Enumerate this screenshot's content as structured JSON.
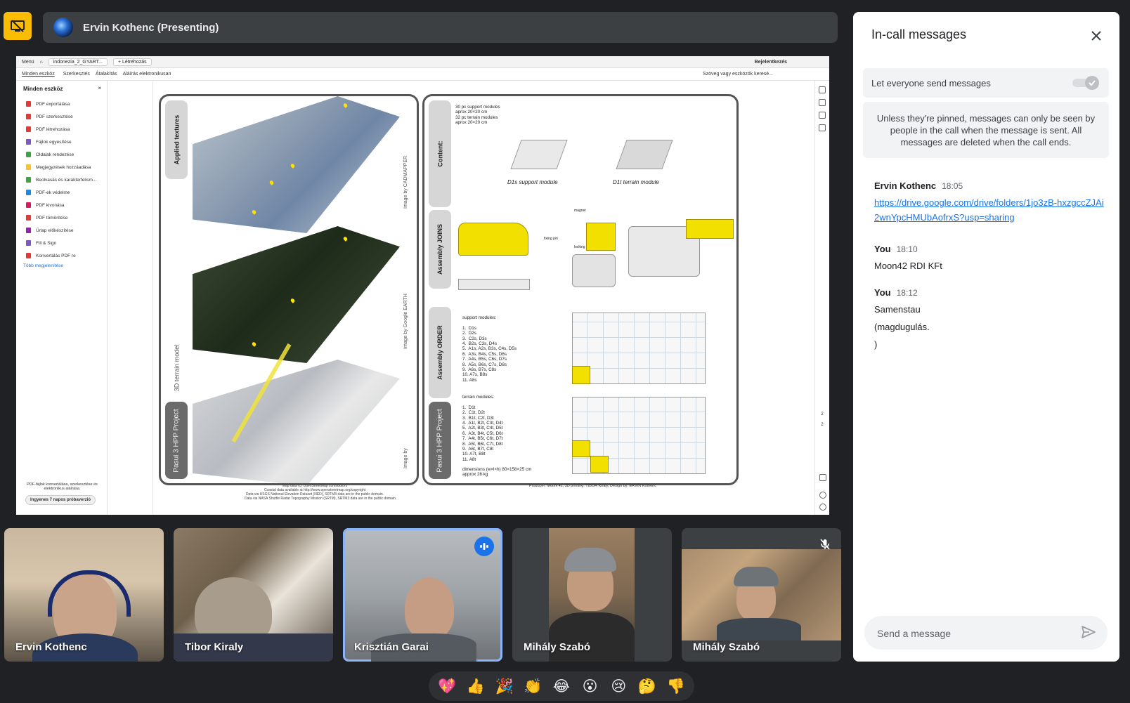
{
  "presenter": {
    "name": "Ervin Kothenc (Presenting)"
  },
  "shared_screen": {
    "toolbar": {
      "menu": "Menü",
      "tab": "indonezia_2_GYART...",
      "new_tab": "+ Létrehozás",
      "signin": "Bejelentkezés"
    },
    "menu_tabs": [
      "Minden eszköz",
      "Szerkesztés",
      "Átalakítás",
      "Aláírás elektronikusan"
    ],
    "search_hint": "Szöveg vagy eszközök keresé...",
    "tools_title": "Minden eszköz",
    "tools": [
      {
        "label": "PDF exportálása",
        "color": "#e53935"
      },
      {
        "label": "PDF szerkesztése",
        "color": "#e53935"
      },
      {
        "label": "PDF létrehozása",
        "color": "#e53935"
      },
      {
        "label": "Fájlok egyesítése",
        "color": "#7e57c2"
      },
      {
        "label": "Oldalak rendezése",
        "color": "#43a047"
      },
      {
        "label": "Megjegyzések hozzáadása",
        "color": "#fbc02d"
      },
      {
        "label": "Beolvasás és karakterfelism...",
        "color": "#43a047"
      },
      {
        "label": "PDF-ek védelme",
        "color": "#1e88e5"
      },
      {
        "label": "PDF kivonása",
        "color": "#d81b60"
      },
      {
        "label": "PDF tömörítése",
        "color": "#e53935"
      },
      {
        "label": "Űrlap előkészítése",
        "color": "#8e24aa"
      },
      {
        "label": "Fill & Sign",
        "color": "#7e57c2"
      },
      {
        "label": "Konvertálás PDF re",
        "color": "#e53935"
      }
    ],
    "tools_more": "Több megjelenítése",
    "tools_footer": "PDF-fájlok konvertálása, szerkesztése és elektronikus aláírása.",
    "tools_trial": "Ingyenes 7 napos próbaverzió",
    "left_panel": {
      "labels": [
        "Applied textures",
        "3D terrain model",
        "Pasui 3 HPP Project"
      ],
      "credits": [
        "Image by CADMAPPER",
        "Image by Google EARTH",
        "Image by"
      ]
    },
    "right_panel": {
      "labels": [
        "Content:",
        "Assembly JOINS",
        "Assembly ORDER",
        "Pasui 3 HPP Project"
      ],
      "content_text": "30 pc support modules\naprox 20×20 cm\n32 pc terrain modules\naprox 20×20 cm",
      "caption_support": "D1s support module",
      "caption_terrain": "D1t terrain module",
      "join_labels": [
        "magnet",
        "fixing pin",
        "locking"
      ],
      "support_list": "support modules:\n\n1.  D1s\n2.  D2s\n3.  C2s, D3s\n4.  B2s, C3s, D4s\n5.  A1s, A2s, B3s, C4s, D5s\n6.  A3s, B4s, C5s, D6s\n7.  A4s, B5s, C6s, D7s\n8.  A5s, B6s, C7s, D8s\n9.  A6s, B7s, C8s\n10. A7s, B8s\n11. A8s",
      "terrain_list": "terrain modules:\n\n1.  D1t\n2.  C1t, D2t\n3.  B1t, C2t, D3t\n4.  A1t, B2t, C3t, D4t\n5.  A2t, B3t, C4t, D5t\n6.  A3t, B4t, C5t, D6t\n7.  A4t, B5t, C6t, D7t\n8.  A5t, B6t, C7t, D8t\n9.  A6t, B7t, C8t\n10. A7t, B8t\n11. A8t",
      "dimensions": "dimensions (w×l×h) 80×158×25 cm\napprox 26 kg"
    },
    "footer_left": "Map data (c) OpenStreetMap contributors\nCoastal data available at http://www.openstreetmap.org/copyright\nData via USGS National Elevation Dataset (NED), SRTM3 data are in the public domain.\nData via NASA Shuttle Radar Topography Mission (SRTM), SRTM3 data are in the public domain.",
    "footer_right": "Producer: MooN 42, 3D printing: TIBOR Király, Design by: ERVIN Kothenc",
    "page_numbers": [
      "2",
      "2"
    ]
  },
  "chat": {
    "title": "In-call messages",
    "toggle_label": "Let everyone send messages",
    "toggle_on": true,
    "pinned_note": "Unless they're pinned, messages can only be seen by people in the call when the message is sent. All messages are deleted when the call ends.",
    "messages": [
      {
        "sender": "Ervin Kothenc",
        "time": "18:05",
        "lines": [
          "https://drive.google.com/drive/folders/1jo3zB-hxzgccZJAi2wnYpcHMUbAofrxS?usp=sharing"
        ],
        "link": true
      },
      {
        "sender": "You",
        "time": "18:10",
        "lines": [
          "Moon42 RDI KFt"
        ],
        "link": false
      },
      {
        "sender": "You",
        "time": "18:12",
        "lines": [
          "Samenstau",
          "(magdugulás.",
          ")"
        ],
        "link": false
      }
    ],
    "input_placeholder": "Send a message"
  },
  "participants": [
    {
      "name": "Ervin Kothenc",
      "active": false,
      "muted": false
    },
    {
      "name": "Tibor Kiraly",
      "active": false,
      "muted": false
    },
    {
      "name": "Krisztián Garai",
      "active": true,
      "muted": false
    },
    {
      "name": "Mihály Szabó",
      "active": false,
      "muted": false
    },
    {
      "name": "Mihály Szabó",
      "active": false,
      "muted": true
    }
  ],
  "reactions": [
    {
      "emoji": "💖",
      "name": "sparkling-heart"
    },
    {
      "emoji": "👍",
      "name": "thumbs-up"
    },
    {
      "emoji": "🎉",
      "name": "party-popper"
    },
    {
      "emoji": "👏",
      "name": "clapping-hands"
    },
    {
      "emoji": "😂",
      "name": "tears-of-joy"
    },
    {
      "emoji": "😮",
      "name": "surprised-face"
    },
    {
      "emoji": "😢",
      "name": "crying-face"
    },
    {
      "emoji": "🤔",
      "name": "thinking-face"
    },
    {
      "emoji": "👎",
      "name": "thumbs-down"
    }
  ],
  "colors": {
    "accent": "#8ab4f8",
    "present_icon": "#fbbc04",
    "speaking": "#1a73e8",
    "link": "#1a73e8"
  }
}
